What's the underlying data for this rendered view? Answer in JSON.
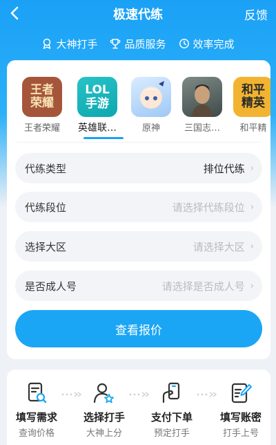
{
  "header": {
    "title": "极速代练",
    "feedback": "反馈"
  },
  "features": [
    {
      "icon": "medal-icon",
      "label": "大神打手"
    },
    {
      "icon": "trophy-icon",
      "label": "品质服务"
    },
    {
      "icon": "clock-icon",
      "label": "效率完成"
    }
  ],
  "games": [
    {
      "label": "王者荣耀",
      "icon_text": "王者荣耀",
      "active": false
    },
    {
      "label": "英雄联…",
      "icon_text": "LOL手游",
      "active": true
    },
    {
      "label": "原神",
      "icon_text": "",
      "active": false
    },
    {
      "label": "三国志…",
      "icon_text": "",
      "active": false
    },
    {
      "label": "和平精",
      "icon_text": "和平精英",
      "active": false
    }
  ],
  "form": {
    "type": {
      "label": "代练类型",
      "value": "排位代练"
    },
    "rank": {
      "label": "代练段位",
      "placeholder": "请选择代练段位"
    },
    "region": {
      "label": "选择大区",
      "placeholder": "请选择大区"
    },
    "adult": {
      "label": "是否成人号",
      "placeholder": "请选择是否成人号"
    }
  },
  "quote_button": "查看报价",
  "steps": [
    {
      "title": "填写需求",
      "sub": "查询价格"
    },
    {
      "title": "选择打手",
      "sub": "大神上分"
    },
    {
      "title": "支付下单",
      "sub": "预定打手"
    },
    {
      "title": "填写账密",
      "sub": "打手上号"
    }
  ],
  "colors": {
    "accent": "#1aa6f5",
    "background": "#eef1f6"
  }
}
